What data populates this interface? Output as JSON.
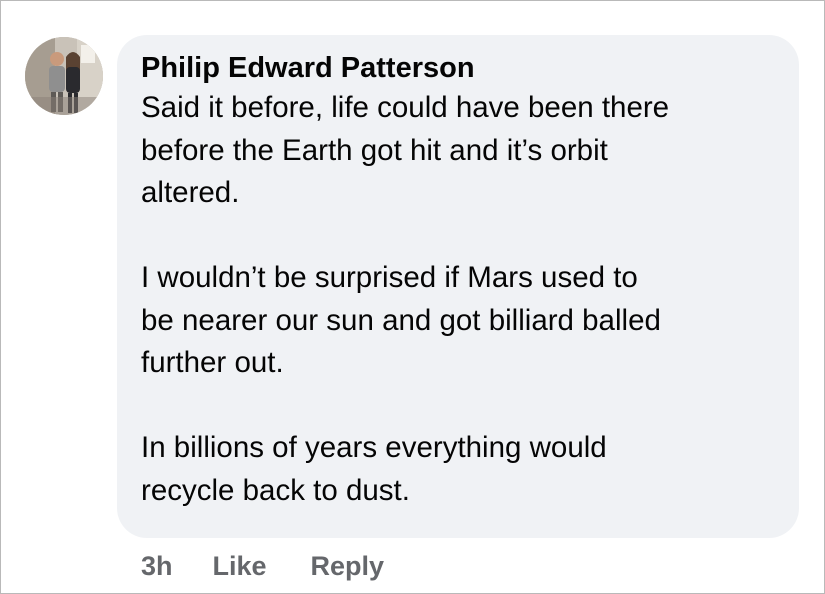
{
  "comment": {
    "author": "Philip Edward Patterson",
    "paragraphs": [
      [
        "Said it before, life could have been there",
        "before the Earth got hit and it’s orbit",
        "altered."
      ],
      [
        "I wouldn’t be surprised if Mars used to",
        "be nearer our sun and got billiard balled",
        "further out."
      ],
      [
        "In billions of years everything would",
        "recycle back to dust."
      ]
    ],
    "timestamp": "3h",
    "like_label": "Like",
    "reply_label": "Reply"
  }
}
